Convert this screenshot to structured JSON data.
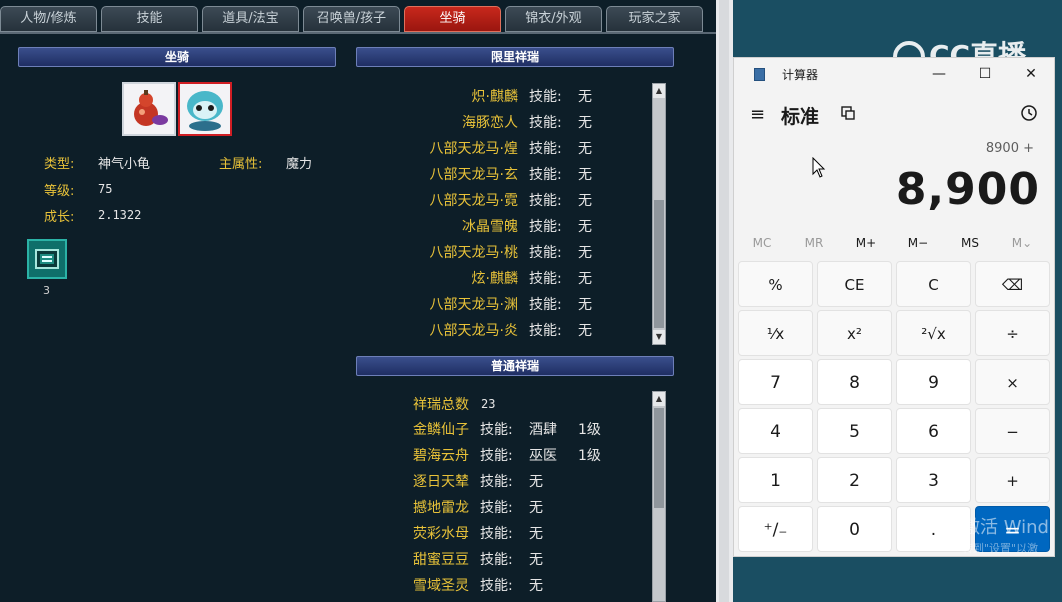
{
  "tabs": [
    "人物/修炼",
    "技能",
    "道具/法宝",
    "召唤兽/孩子",
    "坐骑",
    "锦衣/外观",
    "玩家之家"
  ],
  "active_tab": "坐骑",
  "mount_panel": {
    "header": "坐骑",
    "type_label": "类型:",
    "type_value": "神气小龟",
    "attr_label": "主属性:",
    "attr_value": "魔力",
    "level_label": "等级:",
    "level_value": "75",
    "growth_label": "成长:",
    "growth_value": "2.1322",
    "item_qty": "3"
  },
  "limited_panel": {
    "header": "限里祥瑞",
    "skill_label": "技能:",
    "rows": [
      {
        "name": "炽·麒麟",
        "skill": "无"
      },
      {
        "name": "海豚恋人",
        "skill": "无"
      },
      {
        "name": "八部天龙马·煌",
        "skill": "无"
      },
      {
        "name": "八部天龙马·玄",
        "skill": "无"
      },
      {
        "name": "八部天龙马·霓",
        "skill": "无"
      },
      {
        "name": "冰晶雪魄",
        "skill": "无"
      },
      {
        "name": "八部天龙马·桃",
        "skill": "无"
      },
      {
        "name": "炫·麒麟",
        "skill": "无"
      },
      {
        "name": "八部天龙马·渊",
        "skill": "无"
      },
      {
        "name": "八部天龙马·炎",
        "skill": "无"
      }
    ]
  },
  "normal_panel": {
    "header": "普通祥瑞",
    "total_label": "祥瑞总数",
    "total_value": "23",
    "skill_label": "技能:",
    "rows": [
      {
        "name": "金鳞仙子",
        "skill": "酒肆",
        "level": "1级"
      },
      {
        "name": "碧海云舟",
        "skill": "巫医",
        "level": "1级"
      },
      {
        "name": "逐日天辇",
        "skill": "无",
        "level": ""
      },
      {
        "name": "撼地雷龙",
        "skill": "无",
        "level": ""
      },
      {
        "name": "荧彩水母",
        "skill": "无",
        "level": ""
      },
      {
        "name": "甜蜜豆豆",
        "skill": "无",
        "level": ""
      },
      {
        "name": "雪域圣灵",
        "skill": "无",
        "level": ""
      }
    ]
  },
  "calculator": {
    "title": "计算器",
    "minimize": "—",
    "maximize": "☐",
    "close": "✕",
    "mode": "标准",
    "expression": "8900 +",
    "display": "8,900",
    "memory": [
      "MC",
      "MR",
      "M+",
      "M−",
      "MS",
      "M⌄"
    ],
    "keys": [
      [
        "%",
        "CE",
        "C",
        "⌫"
      ],
      [
        "¹⁄x",
        "x²",
        "²√x",
        "÷"
      ],
      [
        "7",
        "8",
        "9",
        "×"
      ],
      [
        "4",
        "5",
        "6",
        "−"
      ],
      [
        "1",
        "2",
        "3",
        "+"
      ],
      [
        "⁺∕₋",
        "0",
        ".",
        "="
      ]
    ]
  },
  "logo_text": "CC直播",
  "watermark": "激活 Wind",
  "watermark_sub": "转到\"设置\"以激"
}
